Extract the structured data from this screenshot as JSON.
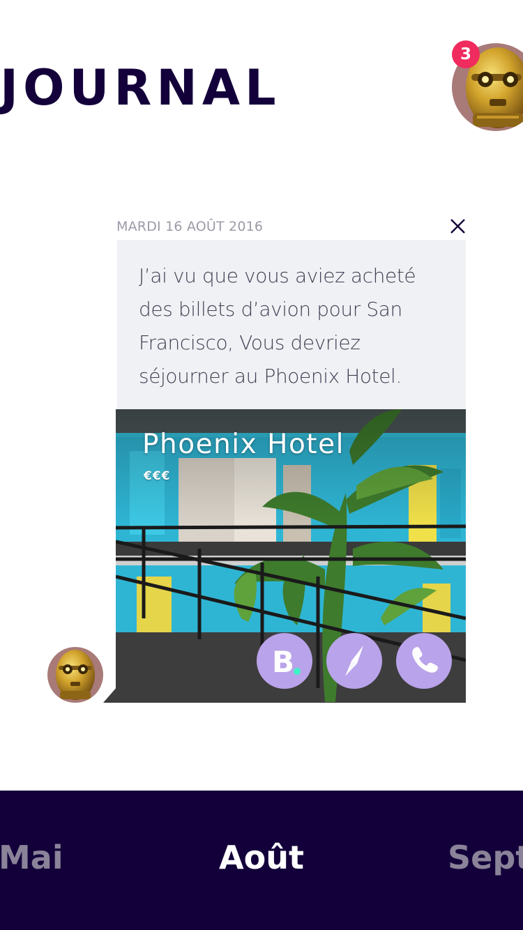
{
  "header": {
    "title": "JOURNAL",
    "notification_count": "3"
  },
  "card": {
    "date": "MARDI 16 AOÛT 2016",
    "message": "J’ai vu que vous aviez acheté des billets d’avion pour San Francisco, Vous devriez séjourner au Phoenix Hotel.",
    "hotel": {
      "name": "Phoenix Hotel",
      "price_level": "€€€"
    },
    "actions": [
      {
        "icon": "booking-b-icon"
      },
      {
        "icon": "compass-icon"
      },
      {
        "icon": "phone-icon"
      }
    ]
  },
  "months": {
    "previous": "Mai",
    "current": "Août",
    "next": "Sept"
  },
  "colors": {
    "navy": "#13003a",
    "badge": "#f02b5e",
    "action": "#b9a3ea",
    "bubble": "#eff1f4",
    "muted_month": "#8a8399"
  }
}
